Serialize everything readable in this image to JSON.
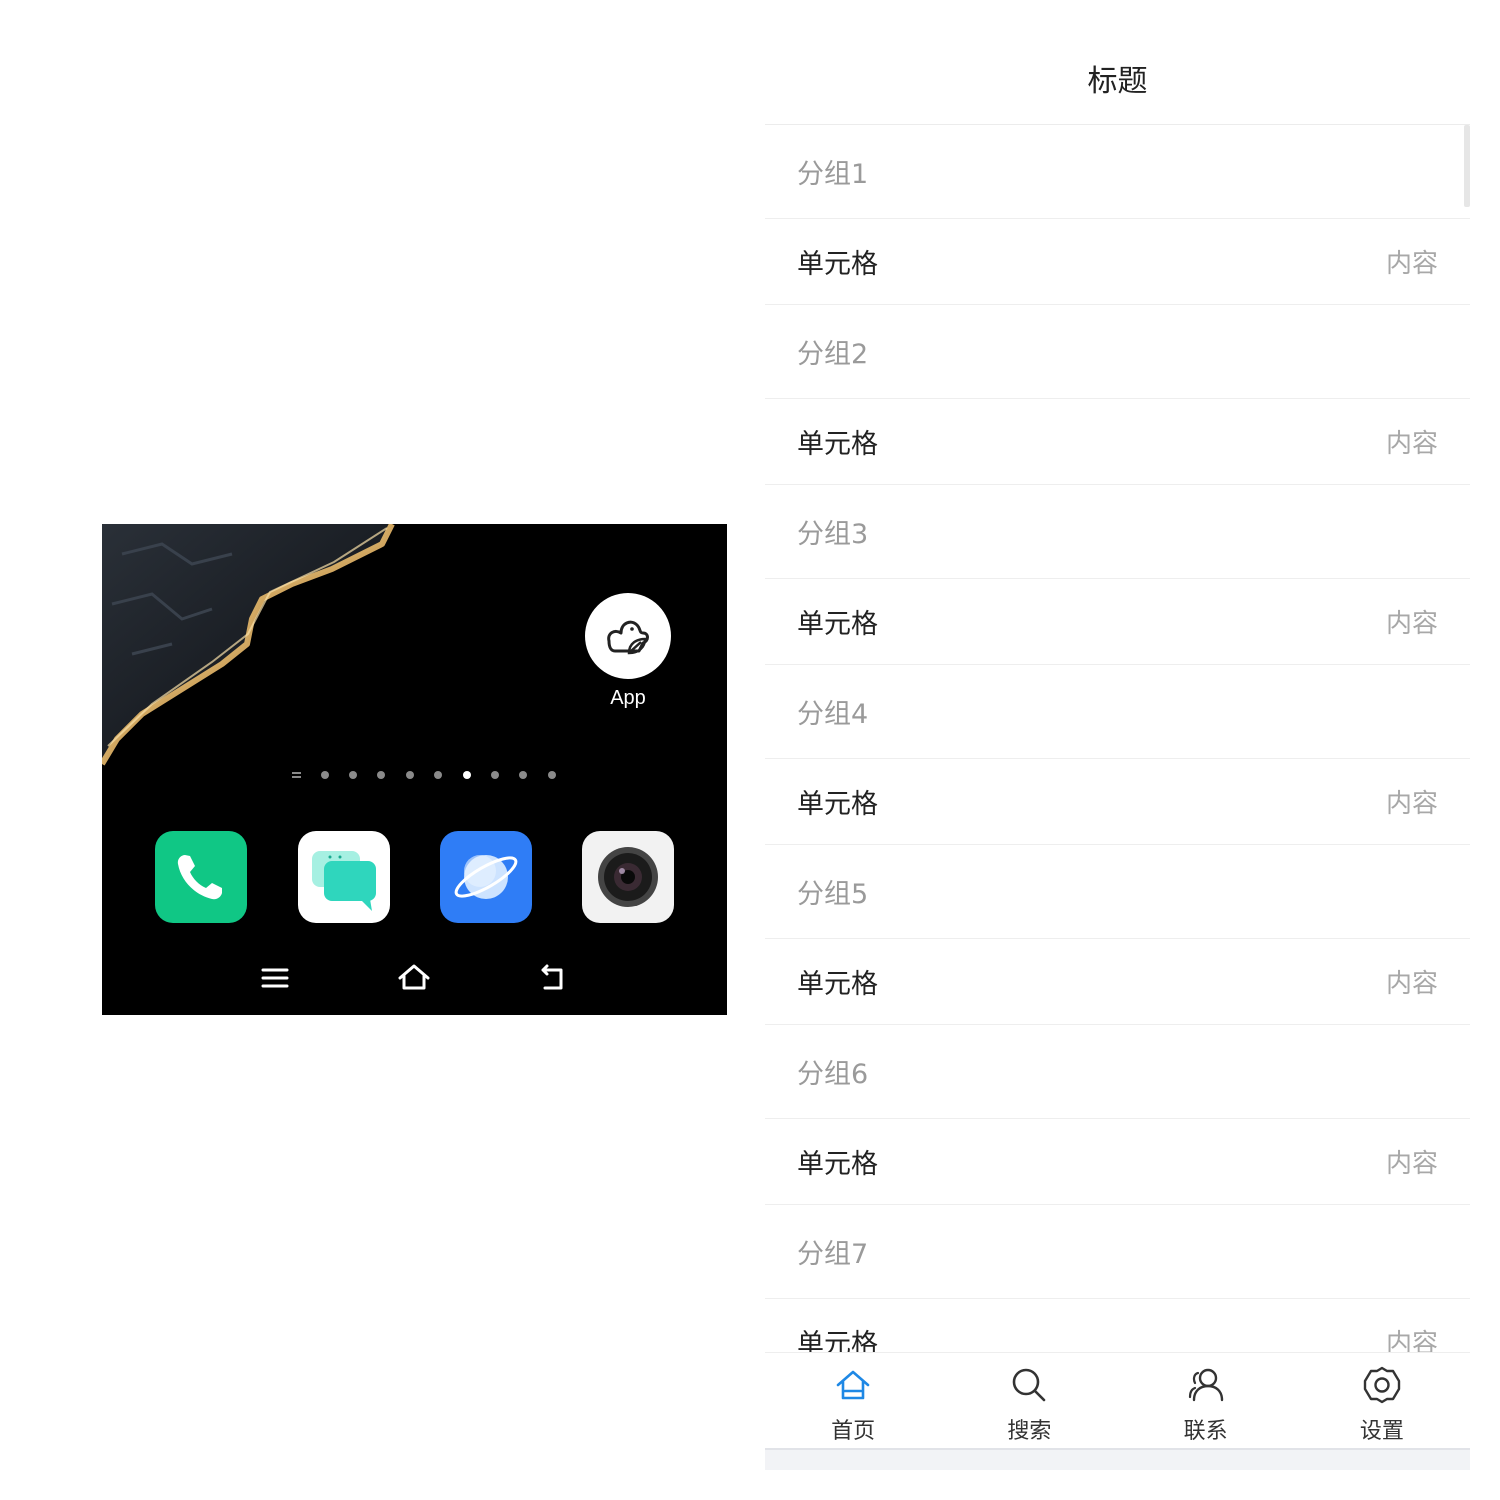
{
  "home_screen": {
    "floating_app": {
      "label": "App",
      "icon": "duck-leaf-icon"
    },
    "page_indicator": {
      "count": 9,
      "active_index": 5
    },
    "dock": [
      {
        "name": "phone-app-icon",
        "color": "#10c785"
      },
      {
        "name": "messages-app-icon",
        "color": "#4fe0c8"
      },
      {
        "name": "browser-app-icon",
        "color": "#2f7df6"
      },
      {
        "name": "camera-app-icon",
        "color": "#f2f2f2"
      }
    ],
    "nav_keys": [
      "menu-icon",
      "home-icon",
      "back-icon"
    ]
  },
  "list_screen": {
    "title": "标题",
    "groups": [
      {
        "header": "分组1",
        "cell": {
          "title": "单元格",
          "value": "内容"
        }
      },
      {
        "header": "分组2",
        "cell": {
          "title": "单元格",
          "value": "内容"
        }
      },
      {
        "header": "分组3",
        "cell": {
          "title": "单元格",
          "value": "内容"
        }
      },
      {
        "header": "分组4",
        "cell": {
          "title": "单元格",
          "value": "内容"
        }
      },
      {
        "header": "分组5",
        "cell": {
          "title": "单元格",
          "value": "内容"
        }
      },
      {
        "header": "分组6",
        "cell": {
          "title": "单元格",
          "value": "内容"
        }
      },
      {
        "header": "分组7",
        "cell": {
          "title": "单元格",
          "value": "内容"
        }
      }
    ],
    "tabs": [
      {
        "label": "首页",
        "icon": "home-icon",
        "active": true
      },
      {
        "label": "搜索",
        "icon": "search-icon",
        "active": false
      },
      {
        "label": "联系",
        "icon": "contacts-icon",
        "active": false
      },
      {
        "label": "设置",
        "icon": "gear-icon",
        "active": false
      }
    ],
    "accent_color": "#1e88e5"
  }
}
